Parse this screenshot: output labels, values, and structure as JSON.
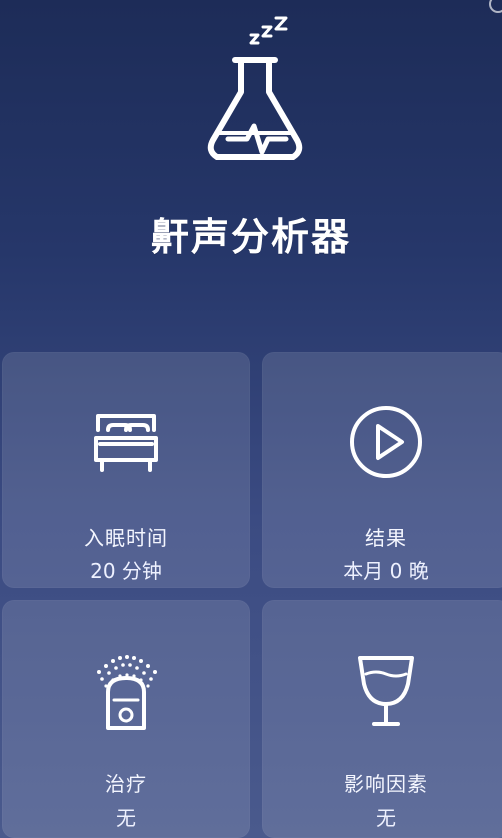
{
  "app": {
    "title": "鼾声分析器"
  },
  "colors": {
    "background_top": "#1d2c58",
    "background_bottom": "#4a5a8d",
    "card_fill": "rgba(255,255,255,0.12)",
    "text_primary": "#ffffff"
  },
  "cards": [
    {
      "label": "入眠时间",
      "value": "20 分钟",
      "icon": "bed-icon"
    },
    {
      "label": "结果",
      "value": "本月 0 晚",
      "icon": "play-circle-icon"
    },
    {
      "label": "治疗",
      "value": "无",
      "icon": "humidifier-icon"
    },
    {
      "label": "影响因素",
      "value": "无",
      "icon": "wine-glass-icon"
    }
  ]
}
